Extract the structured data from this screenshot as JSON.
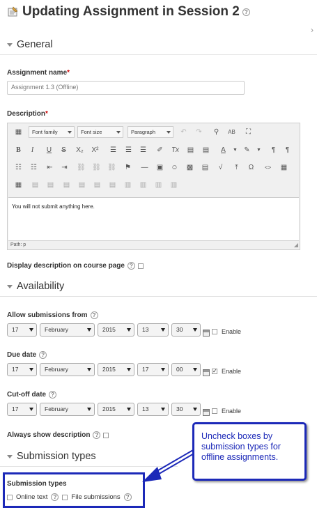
{
  "page": {
    "title": "Updating Assignment in Session 2",
    "right_chevron": "›"
  },
  "general": {
    "section_title": "General",
    "assignment_name_label": "Assignment name",
    "assignment_name_value": "Assignment 1.3 (Offline)",
    "description_label": "Description",
    "required_mark": "*",
    "editor": {
      "font_family": "Font family",
      "font_size": "Font size",
      "paragraph": "Paragraph",
      "content": "You will not submit anything here.",
      "path": "Path: p"
    },
    "display_description_label": "Display description on course page"
  },
  "availability": {
    "section_title": "Availability",
    "enable_label": "Enable",
    "rows": [
      {
        "label": "Allow submissions from",
        "day": "17",
        "month": "February",
        "year": "2015",
        "hour": "13",
        "minute": "30",
        "enabled": false
      },
      {
        "label": "Due date",
        "day": "17",
        "month": "February",
        "year": "2015",
        "hour": "17",
        "minute": "00",
        "enabled": true
      },
      {
        "label": "Cut-off date",
        "day": "17",
        "month": "February",
        "year": "2015",
        "hour": "13",
        "minute": "30",
        "enabled": false
      }
    ],
    "always_show_description_label": "Always show description"
  },
  "submission": {
    "section_title": "Submission types",
    "field_label": "Submission types",
    "online_text_label": "Online text",
    "file_submissions_label": "File submissions"
  },
  "callout": {
    "text": "Uncheck boxes by submission types for offline assignments."
  },
  "colors": {
    "callout_blue": "#1c29b8",
    "required_red": "#cc0000"
  }
}
